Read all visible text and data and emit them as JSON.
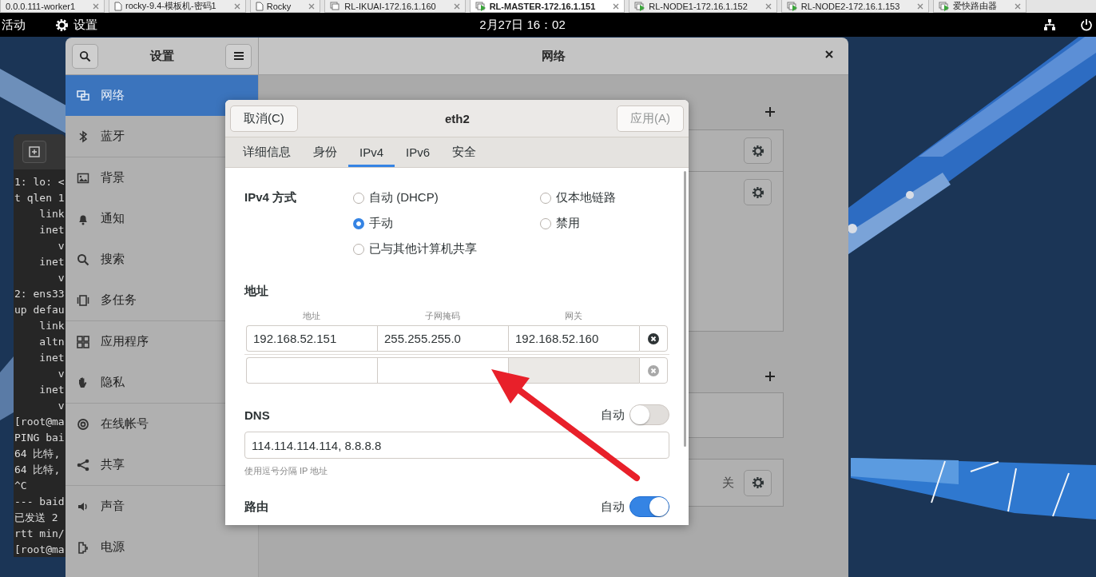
{
  "host_tabs": [
    {
      "label": "0.0.0.111-worker1",
      "selected": false
    },
    {
      "label": "rocky-9.4-模板机-密码1",
      "selected": false,
      "kind": "page"
    },
    {
      "label": "Rocky",
      "selected": false,
      "kind": "page"
    },
    {
      "label": "RL-IKUAI-172.16.1.160",
      "selected": false,
      "kind": "vm"
    },
    {
      "label": "RL-MASTER-172.16.1.151",
      "selected": true,
      "kind": "vm-running"
    },
    {
      "label": "RL-NODE1-172.16.1.152",
      "selected": false,
      "kind": "vm-running"
    },
    {
      "label": "RL-NODE2-172.16.1.153",
      "selected": false,
      "kind": "vm-running"
    },
    {
      "label": "爱快路由器",
      "selected": false,
      "kind": "vm-running"
    }
  ],
  "top_bar": {
    "activities": "活动",
    "app_menu": "设置",
    "clock": "2月27日 16：02"
  },
  "terminal": {
    "lines": [
      "1: lo: <",
      "t qlen 1",
      "    link",
      "    inet",
      "       v",
      "    inet",
      "       v",
      "2: ens33",
      "up defau",
      "    link",
      "    altn",
      "    inet",
      "       v",
      "    inet",
      "       v",
      "[root@ma",
      "PING bai",
      "64 比特,",
      "64 比特,",
      "^C",
      "--- baid",
      "已发送 2",
      "rtt min/",
      "[root@ma"
    ]
  },
  "settings": {
    "sidebar_title": "设置",
    "panel_title": "网络",
    "sidebar": {
      "groups": [
        [
          {
            "label": "网络",
            "selected": true
          },
          {
            "label": "蓝牙",
            "selected": false
          }
        ],
        [
          {
            "label": "背景",
            "selected": false
          },
          {
            "label": "通知",
            "selected": false
          },
          {
            "label": "搜索",
            "selected": false
          },
          {
            "label": "多任务",
            "selected": false
          }
        ],
        [
          {
            "label": "应用程序",
            "selected": false
          },
          {
            "label": "隐私",
            "selected": false
          }
        ],
        [
          {
            "label": "在线帐号",
            "selected": false
          },
          {
            "label": "共享",
            "selected": false
          }
        ],
        [
          {
            "label": "声音",
            "selected": false
          },
          {
            "label": "电源",
            "selected": false
          }
        ]
      ]
    },
    "panel": {
      "proxy_status": "关"
    }
  },
  "dialog": {
    "cancel": "取消(C)",
    "title": "eth2",
    "apply": {
      "label": "应用(A)",
      "disabled": true
    },
    "tabs": [
      {
        "label": "详细信息",
        "selected": false
      },
      {
        "label": "身份",
        "selected": false
      },
      {
        "label": "IPv4",
        "selected": true
      },
      {
        "label": "IPv6",
        "selected": false
      },
      {
        "label": "安全",
        "selected": false
      }
    ],
    "method": {
      "label": "IPv4 方式",
      "options": [
        {
          "label": "自动 (DHCP)",
          "selected": false
        },
        {
          "label": "仅本地链路",
          "selected": false
        },
        {
          "label": "手动",
          "selected": true
        },
        {
          "label": "禁用",
          "selected": false
        },
        {
          "label": "已与其他计算机共享",
          "selected": false
        }
      ]
    },
    "addresses": {
      "label": "地址",
      "columns": [
        "地址",
        "子网掩码",
        "网关"
      ],
      "rows": [
        {
          "address": "192.168.52.151",
          "netmask": "255.255.255.0",
          "gateway": "192.168.52.160",
          "disabled": false
        },
        {
          "disabled": true
        }
      ]
    },
    "dns": {
      "label": "DNS",
      "auto_label": "自动",
      "auto": false,
      "value": "114.114.114.114, 8.8.8.8",
      "hint": "使用逗号分隔 IP 地址"
    },
    "routes": {
      "label": "路由",
      "auto_label": "自动",
      "auto": true
    }
  }
}
